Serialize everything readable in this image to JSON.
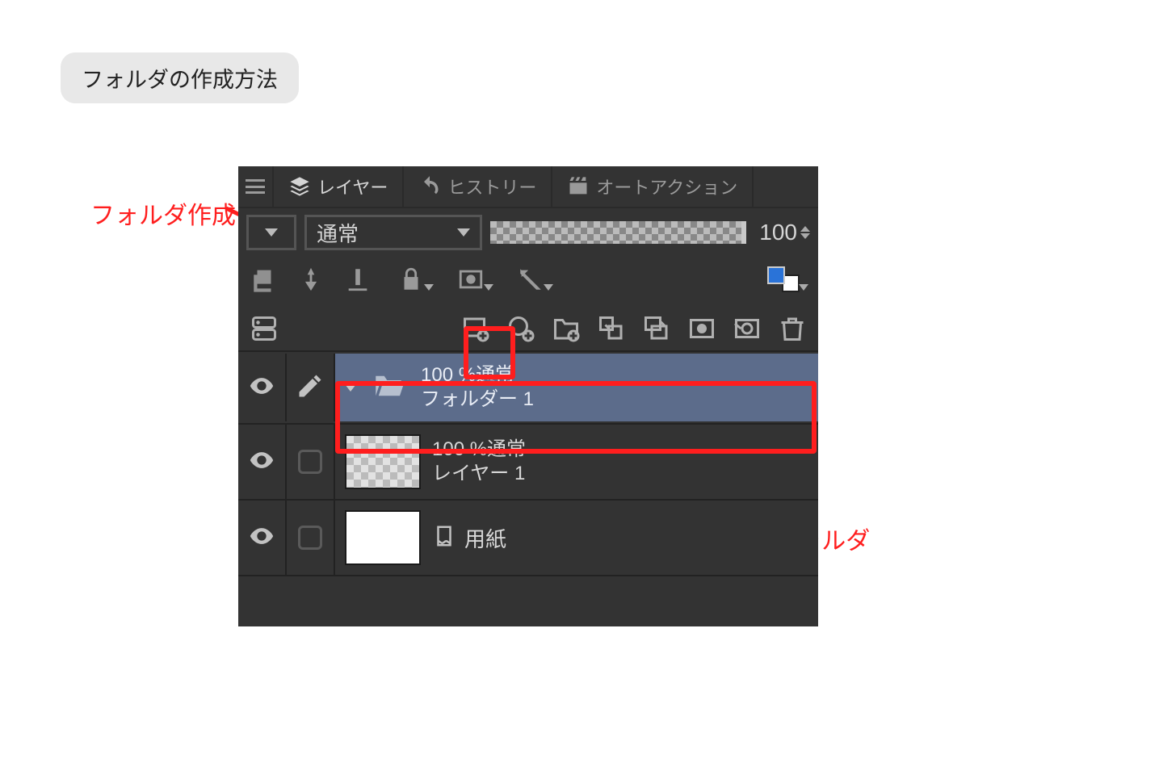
{
  "title_badge": "フォルダの作成方法",
  "tabs": {
    "layer": "レイヤー",
    "history": "ヒストリー",
    "auto_action": "オートアクション"
  },
  "blend": {
    "mode": "通常",
    "opacity_value": "100"
  },
  "layers": {
    "folder": {
      "line1": "100 %通常",
      "line2": "フォルダー 1"
    },
    "raster": {
      "line1": "100 %通常",
      "line2": "レイヤー 1"
    },
    "paper": "用紙"
  },
  "annotations": {
    "create_folder": "フォルダ作成",
    "layer_folder": "レイヤーフォルダ"
  }
}
